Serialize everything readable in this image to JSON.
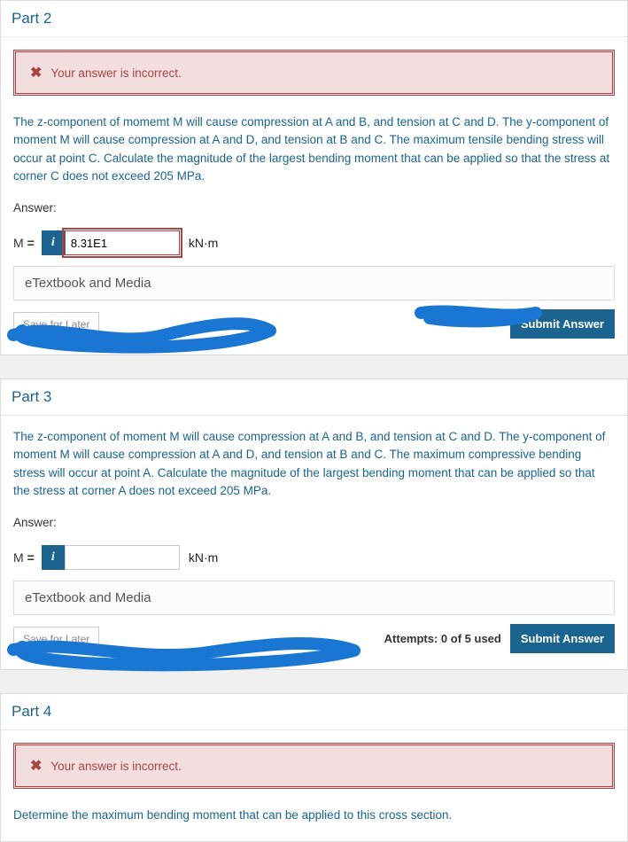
{
  "part2": {
    "title": "Part 2",
    "error_msg": "Your answer is incorrect.",
    "question": "The z-component of momemt M will cause compression at A and B, and tension at C and D. The y-component of moment M will cause compression at A and D, and tension at B and C. The maximum tensile bending stress will occur at point C. Calculate the magnitude of the largest bending moment that can be applied so that the stress at corner C does not exceed 205 MPa.",
    "answer_label": "Answer:",
    "var": "M",
    "eq": "=",
    "value": "8.31E1",
    "unit": "kN·m",
    "etextbook": "eTextbook and Media",
    "save": "Save for Later",
    "submit": "Submit Answer"
  },
  "part3": {
    "title": "Part 3",
    "question": "The z-component of moment M will cause compression at A and B, and tension at C and D. The y-component of moment M will cause compression at A and D, and tension at B and C. The maximum compressive bending stress will occur at point A. Calculate the magnitude of the largest bending moment that can be applied so that the stress at corner A does not exceed 205 MPa.",
    "answer_label": "Answer:",
    "var": "M",
    "eq": "=",
    "value": "",
    "unit": "kN·m",
    "etextbook": "eTextbook and Media",
    "save": "Save for Later",
    "attempts": "Attempts: 0 of 5 used",
    "submit": "Submit Answer"
  },
  "part4": {
    "title": "Part 4",
    "error_msg": "Your answer is incorrect.",
    "question": "Determine the maximum bending moment that can be applied to this cross section."
  }
}
